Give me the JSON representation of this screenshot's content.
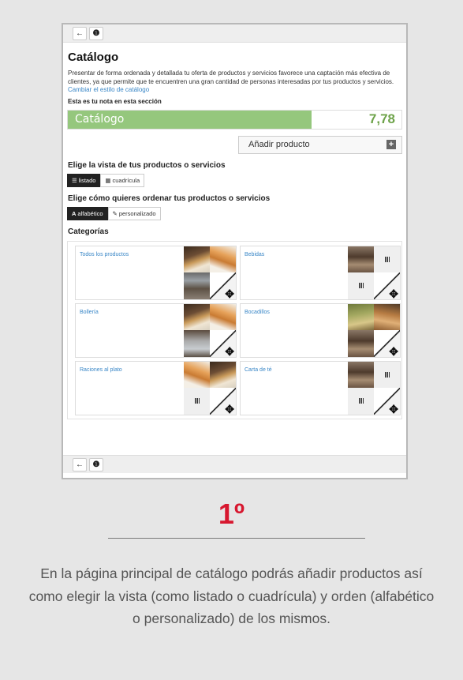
{
  "toolbar": {
    "back_icon": "arrow-left-icon",
    "info_icon": "info-icon",
    "back_glyph": "←",
    "info_glyph": "❶"
  },
  "page": {
    "title": "Catálogo",
    "description": "Presentar de forma ordenada y detallada tu oferta de productos y servicios favorece una captación más efectiva de clientes, ya que permite que te encuentren una gran cantidad de personas interesadas por tus productos y servicios.",
    "change_style_link": "Cambiar el estilo de catálogo",
    "note_label": "Esta es tu nota en esta sección",
    "grade_label": "Catálogo",
    "grade_value": "7,78",
    "grade_color": "#95c77d",
    "add_product": "Añadir producto",
    "view_heading": "Elige la vista de tus productos o servicios",
    "view_options": [
      "listado",
      "cuadrícula"
    ],
    "view_selected": "listado",
    "order_heading": "Elige cómo quieres ordenar tus productos o servicios",
    "order_options": [
      "alfabético",
      "personalizado"
    ],
    "order_selected": "alfabético",
    "categories_heading": "Categorías",
    "categories": [
      {
        "name": "Todos los productos"
      },
      {
        "name": "Bebidas"
      },
      {
        "name": "Bollería"
      },
      {
        "name": "Bocadillos"
      },
      {
        "name": "Raciones al plato"
      },
      {
        "name": "Carta de té"
      }
    ]
  },
  "footer": {
    "step": "1º",
    "step_color": "#d7172f",
    "caption": "En la página principal de catálogo podrás añadir productos así como elegir la vista (como listado o cuadrícula) y orden (alfabético o personalizado) de los mismos."
  }
}
